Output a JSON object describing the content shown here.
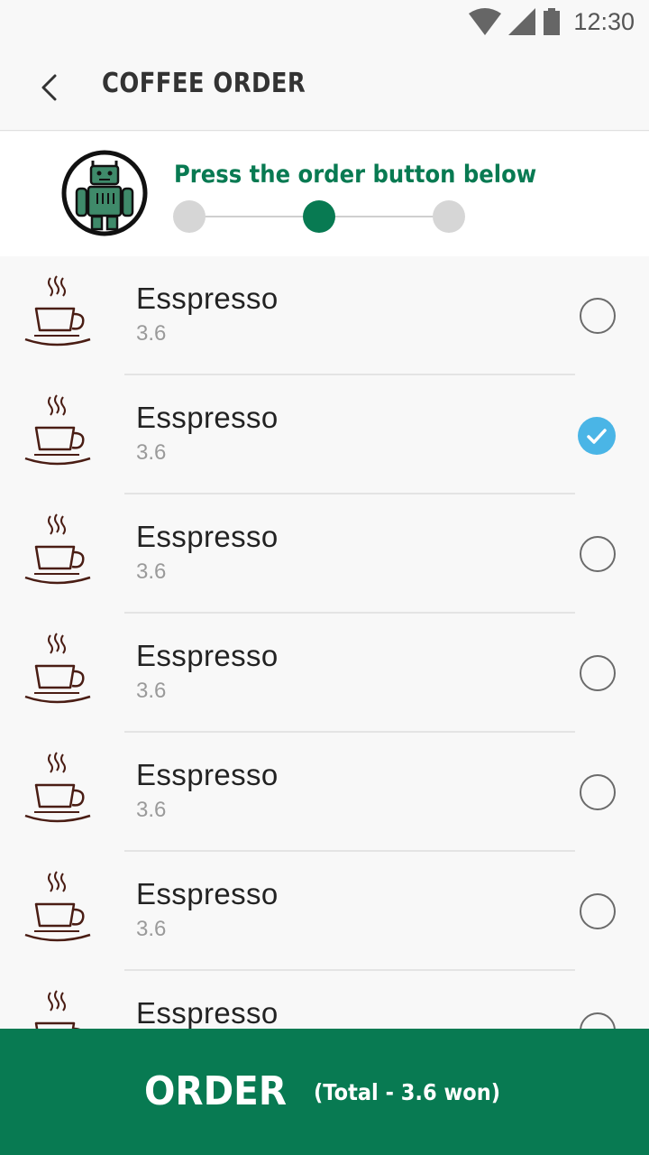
{
  "status_bar": {
    "time": "12:30",
    "icons": [
      "wifi-icon",
      "signal-icon",
      "battery-icon"
    ]
  },
  "app_bar": {
    "back_icon": "chevron-left-icon",
    "title": "COFFEE ORDER"
  },
  "header": {
    "avatar_icon": "robot-icon",
    "instruction": "Press the order button below",
    "steps_total": 3,
    "active_step": 2
  },
  "menu": {
    "items": [
      {
        "icon": "coffee-cup-icon",
        "name": "Esspresso",
        "price": "3.6",
        "selected": false
      },
      {
        "icon": "coffee-cup-icon",
        "name": "Esspresso",
        "price": "3.6",
        "selected": true
      },
      {
        "icon": "coffee-cup-icon",
        "name": "Esspresso",
        "price": "3.6",
        "selected": false
      },
      {
        "icon": "coffee-cup-icon",
        "name": "Esspresso",
        "price": "3.6",
        "selected": false
      },
      {
        "icon": "coffee-cup-icon",
        "name": "Esspresso",
        "price": "3.6",
        "selected": false
      },
      {
        "icon": "coffee-cup-icon",
        "name": "Esspresso",
        "price": "3.6",
        "selected": false
      },
      {
        "icon": "coffee-cup-icon",
        "name": "Esspresso",
        "price": "",
        "selected": false
      }
    ]
  },
  "order_button": {
    "label": "ORDER",
    "total": "(Total - 3.6 won)"
  },
  "colors": {
    "brand_green": "#087a52",
    "check_blue": "#4ab5e6",
    "background": "#f8f8f8"
  }
}
